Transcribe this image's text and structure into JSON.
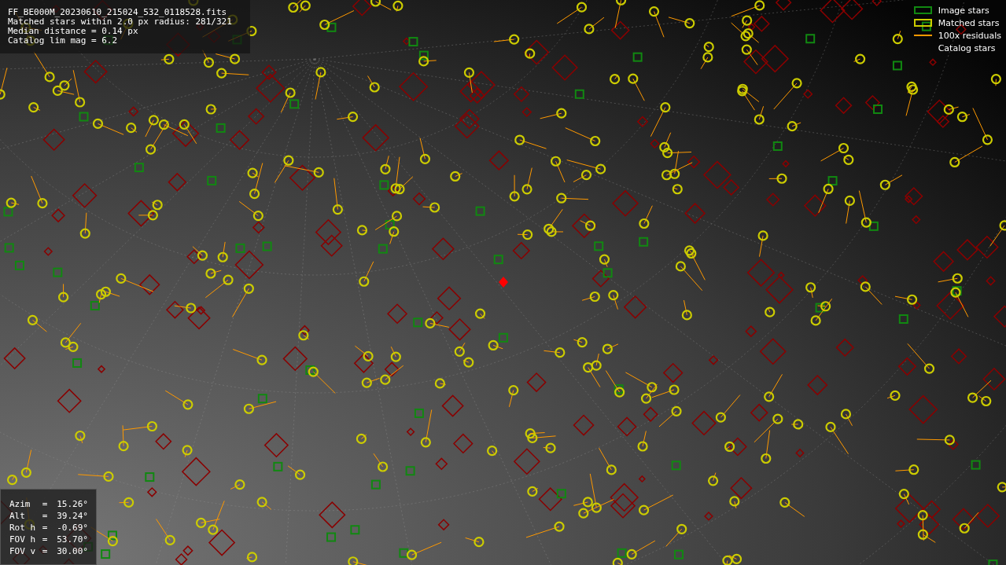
{
  "info_box": {
    "lines": [
      "FF_BE000M_20230610_215024_532_0118528.fits",
      "Matched stars within 2.0 px radius: 281/321",
      "Median distance = 0.14 px",
      "Catalog lim mag = 6.2"
    ]
  },
  "legend": [
    {
      "label": "Image stars",
      "kind": "square",
      "color": "#118811"
    },
    {
      "label": "Matched stars",
      "kind": "circle",
      "color": "#cccc00"
    },
    {
      "label": "100x residuals",
      "kind": "line",
      "color": "#ff9900"
    },
    {
      "label": "Catalog stars",
      "kind": "none"
    }
  ],
  "pointing": [
    {
      "label": "Azim",
      "sep": "=",
      "value": "15.26°"
    },
    {
      "label": "Alt",
      "sep": "=",
      "value": "39.24°"
    },
    {
      "label": "Rot h",
      "sep": "=",
      "value": "-0.69°"
    },
    {
      "label": "FOV h",
      "sep": "=",
      "value": "53.70°"
    },
    {
      "label": "FOV v",
      "sep": "=",
      "value": "30.00°"
    }
  ]
}
